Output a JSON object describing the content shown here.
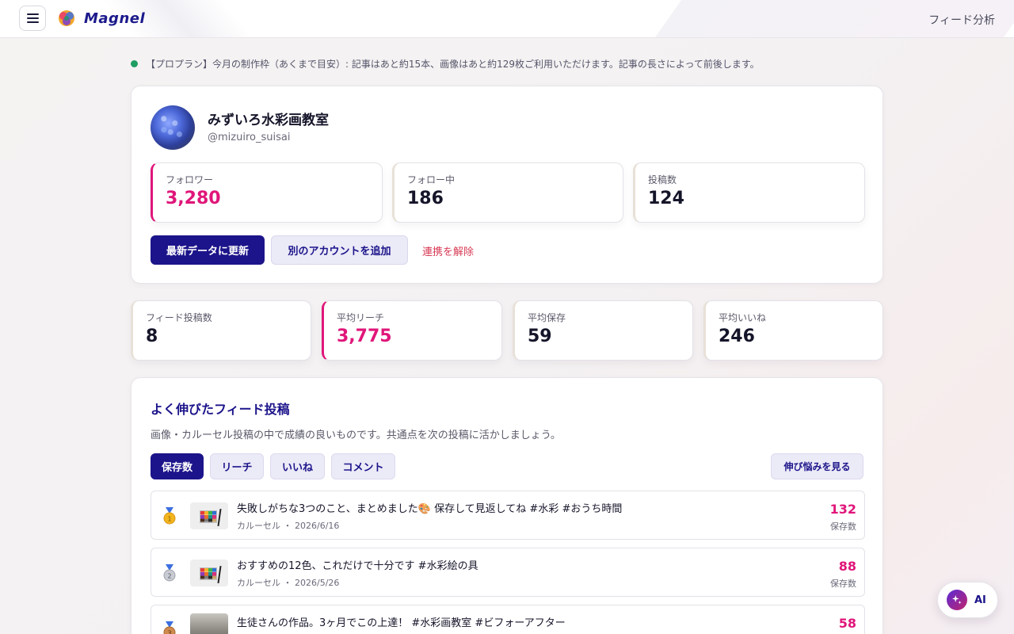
{
  "header": {
    "app_name": "Magnel",
    "page_name": "フィード分析"
  },
  "notice": "【プロプラン】今月の制作枠（あくまで目安）: 記事はあと約15本、画像はあと約129枚ご利用いただけます。記事の長さによって前後します。",
  "profile": {
    "name": "みずいろ水彩画教室",
    "handle": "@mizuiro_suisai",
    "stats": [
      {
        "label": "フォロワー",
        "value": "3,280"
      },
      {
        "label": "フォロー中",
        "value": "186"
      },
      {
        "label": "投稿数",
        "value": "124"
      }
    ],
    "refresh_label": "最新データに更新",
    "add_account_label": "別のアカウントを追加",
    "unlink_label": "連携を解除"
  },
  "summary": [
    {
      "label": "フィード投稿数",
      "value": "8"
    },
    {
      "label": "平均リーチ",
      "value": "3,775"
    },
    {
      "label": "平均保存",
      "value": "59"
    },
    {
      "label": "平均いいね",
      "value": "246"
    }
  ],
  "top_posts": {
    "title": "よく伸びたフィード投稿",
    "description": "画像・カルーセル投稿の中で成績の良いものです。共通点を次の投稿に活かしましょう。",
    "tabs": [
      "保存数",
      "リーチ",
      "いいね",
      "コメント"
    ],
    "active_tab": "保存数",
    "more_label": "伸び悩みを見る",
    "posts": [
      {
        "rank": 1,
        "title": "失敗しがちな3つのこと、まとめました🎨 保存して見返してね #水彩 #おうち時間",
        "meta": "カルーセル ・ 2026/6/16",
        "value": "132",
        "unit": "保存数"
      },
      {
        "rank": 2,
        "title": "おすすめの12色、これだけで十分です #水彩絵の具",
        "meta": "カルーセル ・ 2026/5/26",
        "value": "88",
        "unit": "保存数"
      },
      {
        "rank": 3,
        "title": "生徒さんの作品。3ヶ月でこの上達！ #水彩画教室 #ビフォーアフター",
        "meta": "",
        "value": "58",
        "unit": ""
      }
    ]
  },
  "ai_button": {
    "label": "AI"
  },
  "colors": {
    "brand": "#1c148a",
    "accent": "#e0167a",
    "danger": "#d83a55",
    "status_dot": "#1f9d63"
  }
}
